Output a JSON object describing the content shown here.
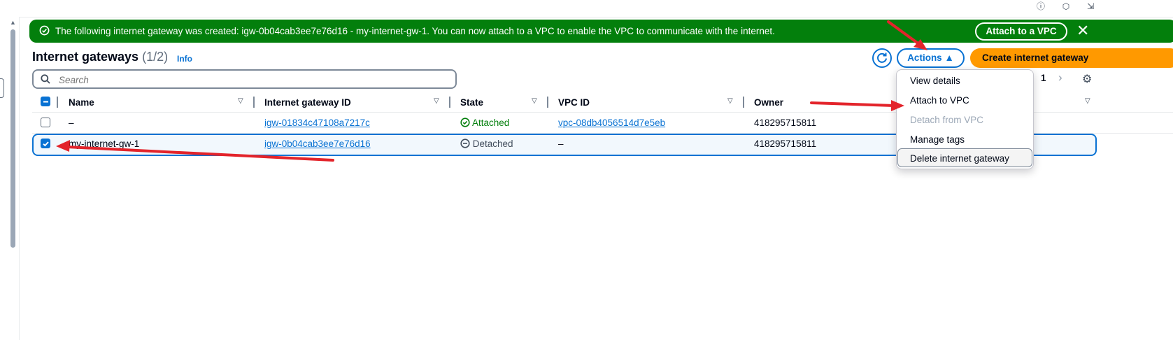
{
  "topbar": {
    "icons": [
      "info-icon",
      "help-icon",
      "export-icon"
    ]
  },
  "flash": {
    "message": "The following internet gateway was created: igw-0b04cab3ee7e76d16 - my-internet-gw-1. You can now attach to a VPC to enable the VPC to communicate with the internet.",
    "attach_button": "Attach to a VPC",
    "close": "✕",
    "color": "#037f0c"
  },
  "header": {
    "title": "Internet gateways",
    "count": "(1/2)",
    "info": "Info",
    "actions": "Actions ▲",
    "create": "Create internet gateway"
  },
  "search": {
    "placeholder": "Search"
  },
  "pagination": {
    "page": "1",
    "next": "›"
  },
  "columns": [
    "Name",
    "Internet gateway ID",
    "State",
    "VPC ID",
    "Owner"
  ],
  "rows": [
    {
      "name": "–",
      "igw_id": "igw-01834c47108a7217c",
      "state": "Attached",
      "vpc_id": "vpc-08db4056514d7e5eb",
      "owner": "418295715811",
      "checked": false
    },
    {
      "name": "my-internet-gw-1",
      "igw_id": "igw-0b04cab3ee7e76d16",
      "state": "Detached",
      "vpc_id": "–",
      "owner": "418295715811",
      "checked": true
    }
  ],
  "menu": {
    "items": [
      "View details",
      "Attach to VPC",
      "Detach from VPC",
      "Manage tags",
      "Delete internet gateway"
    ],
    "disabled": [
      "Detach from VPC"
    ]
  },
  "colors": {
    "accent": "#0972d3",
    "primary": "#ff9900",
    "success": "#037f0c",
    "annotation": "#e3242b"
  }
}
